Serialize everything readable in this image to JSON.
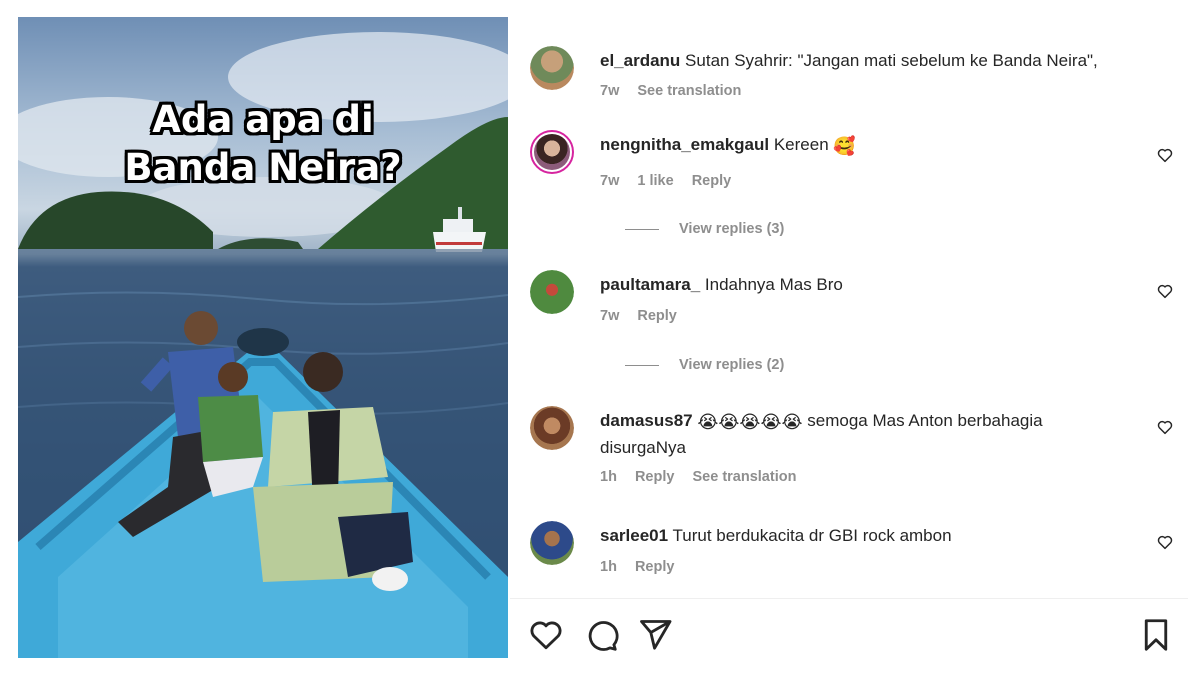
{
  "post": {
    "overlay_line1": "Ada apa di",
    "overlay_line2": "Banda Neira?"
  },
  "comments": [
    {
      "username": "el_ardanu",
      "text": "Sutan Syahrir: \"Jangan mati sebelum ke Banda Neira\",",
      "time": "7w",
      "actions": [
        "See translation"
      ]
    },
    {
      "username": "nengnitha_emakgaul",
      "text": "Kereen",
      "emoji": "🥰",
      "time": "7w",
      "likes": "1 like",
      "actions": [
        "Reply"
      ],
      "view_replies": "View replies (3)"
    },
    {
      "username": "paultamara_",
      "text": "Indahnya Mas Bro",
      "time": "7w",
      "actions": [
        "Reply"
      ],
      "view_replies": "View replies (2)"
    },
    {
      "username": "damasus87",
      "emoji": "😭😭😭😭😭",
      "text": "semoga Mas Anton berbahagia",
      "text_line2": "disurgaNya",
      "time": "1h",
      "actions": [
        "Reply",
        "See translation"
      ]
    },
    {
      "username": "sarlee01",
      "text": "Turut berdukacita dr GBI rock ambon",
      "time": "1h",
      "actions": [
        "Reply"
      ]
    }
  ],
  "icons": {
    "like": "heart-icon",
    "comment": "comment-icon",
    "share": "send-icon",
    "save": "bookmark-icon"
  },
  "colors": {
    "text": "#262626",
    "muted": "#8e8e8e",
    "boat": "#3fa9d8"
  }
}
